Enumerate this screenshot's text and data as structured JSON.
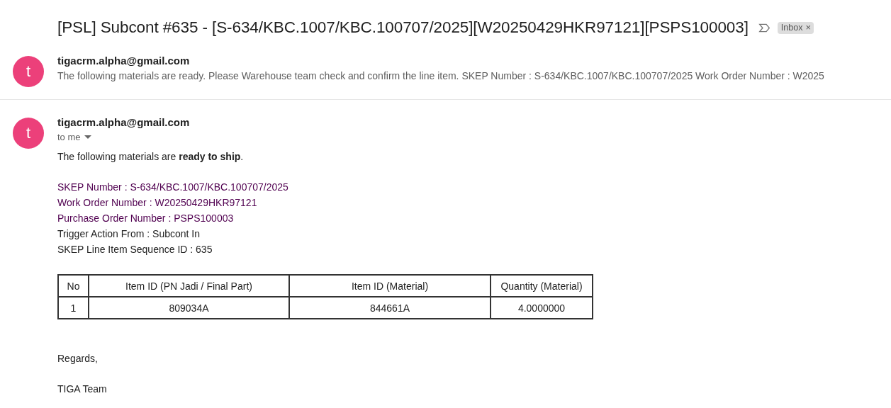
{
  "subject": "[PSL] Subcont #635 - [S-634/KBC.1007/KBC.100707/2025][W20250429HKR97121][PSPS100003]",
  "label": {
    "text": "Inbox",
    "close": "×"
  },
  "messages": [
    {
      "kind": "collapsed",
      "avatar": "t",
      "sender": "tigacrm.alpha@gmail.com",
      "snippet": "The following materials are ready. Please Warehouse team check and confirm the line item. SKEP Number : S-634/KBC.1007/KBC.100707/2025 Work Order Number : W2025"
    },
    {
      "kind": "expanded",
      "avatar": "t",
      "sender": "tigacrm.alpha@gmail.com",
      "recipient": "to me",
      "intro": "The following materials are **ready to ship**.",
      "fields": [
        {
          "text": "SKEP Number : S-634/KBC.1007/KBC.100707/2025",
          "color": "#500050"
        },
        {
          "text": "Work Order Number : W20250429HKR97121",
          "color": "#500050"
        },
        {
          "text": "Purchase Order Number : PSPS100003",
          "color": "#500050"
        },
        {
          "text": "Trigger Action From : Subcont In",
          "color": "#222222"
        },
        {
          "text": "SKEP Line Item Sequence ID : 635",
          "color": "#222222"
        }
      ],
      "table": {
        "columns": [
          "No",
          "Item ID (PN Jadi / Final Part)",
          "Item ID (Material)",
          "Quantity (Material)"
        ],
        "rows": [
          [
            "1",
            "809034A",
            "844661A",
            "4.0000000"
          ]
        ]
      },
      "closing": "Regards,",
      "signature": "TIGA Team"
    }
  ]
}
